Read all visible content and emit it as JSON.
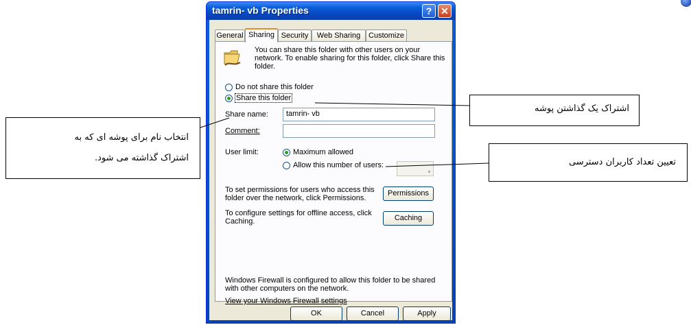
{
  "window": {
    "title": "tamrin- vb Properties",
    "help_label": "?",
    "close_label": "✕"
  },
  "tabs": [
    {
      "label": "General",
      "active": false
    },
    {
      "label": "Sharing",
      "active": true
    },
    {
      "label": "Security",
      "active": false
    },
    {
      "label": "Web Sharing",
      "active": false
    },
    {
      "label": "Customize",
      "active": false
    }
  ],
  "sharing": {
    "intro_line1": "You can share this folder with other users on your",
    "intro_line2": "network.  To enable sharing for this folder, click Share this",
    "intro_line3": "folder.",
    "radio_not_share": "Do not share this folder",
    "radio_share": "Share this folder",
    "share_name_label": "Share name:",
    "share_name_value": "tamrin- vb",
    "comment_label": "Comment:",
    "comment_value": "",
    "user_limit_label": "User limit:",
    "max_allowed": "Maximum allowed",
    "allow_number": "Allow this number of users:",
    "permissions_text1": "To set permissions for users who access this",
    "permissions_text2": "folder over the network, click Permissions.",
    "permissions_button": "Permissions",
    "caching_text1": "To configure settings for offline access, click",
    "caching_text2": "Caching.",
    "caching_button": "Caching",
    "firewall_text1": "Windows Firewall is configured to allow this folder to be shared",
    "firewall_text2": "with other computers on the network.",
    "firewall_link": "View your Windows Firewall settings"
  },
  "buttons": {
    "ok": "OK",
    "cancel": "Cancel",
    "apply": "Apply"
  },
  "callouts": {
    "share_folder": "اشتراک یک گذاشتن پوشه",
    "choose_name_line1": "انتخاب نام برای پوشه ای که به",
    "choose_name_line2": "اشتراک گذاشته می شود.",
    "user_count": "تعیین تعداد کاربران دسترسی"
  },
  "colors": {
    "title_bar": "#0a5fd8",
    "dialog_face": "#ece9d8",
    "tab_active_accent": "#e68b2c",
    "radio_dot": "#21a121"
  }
}
